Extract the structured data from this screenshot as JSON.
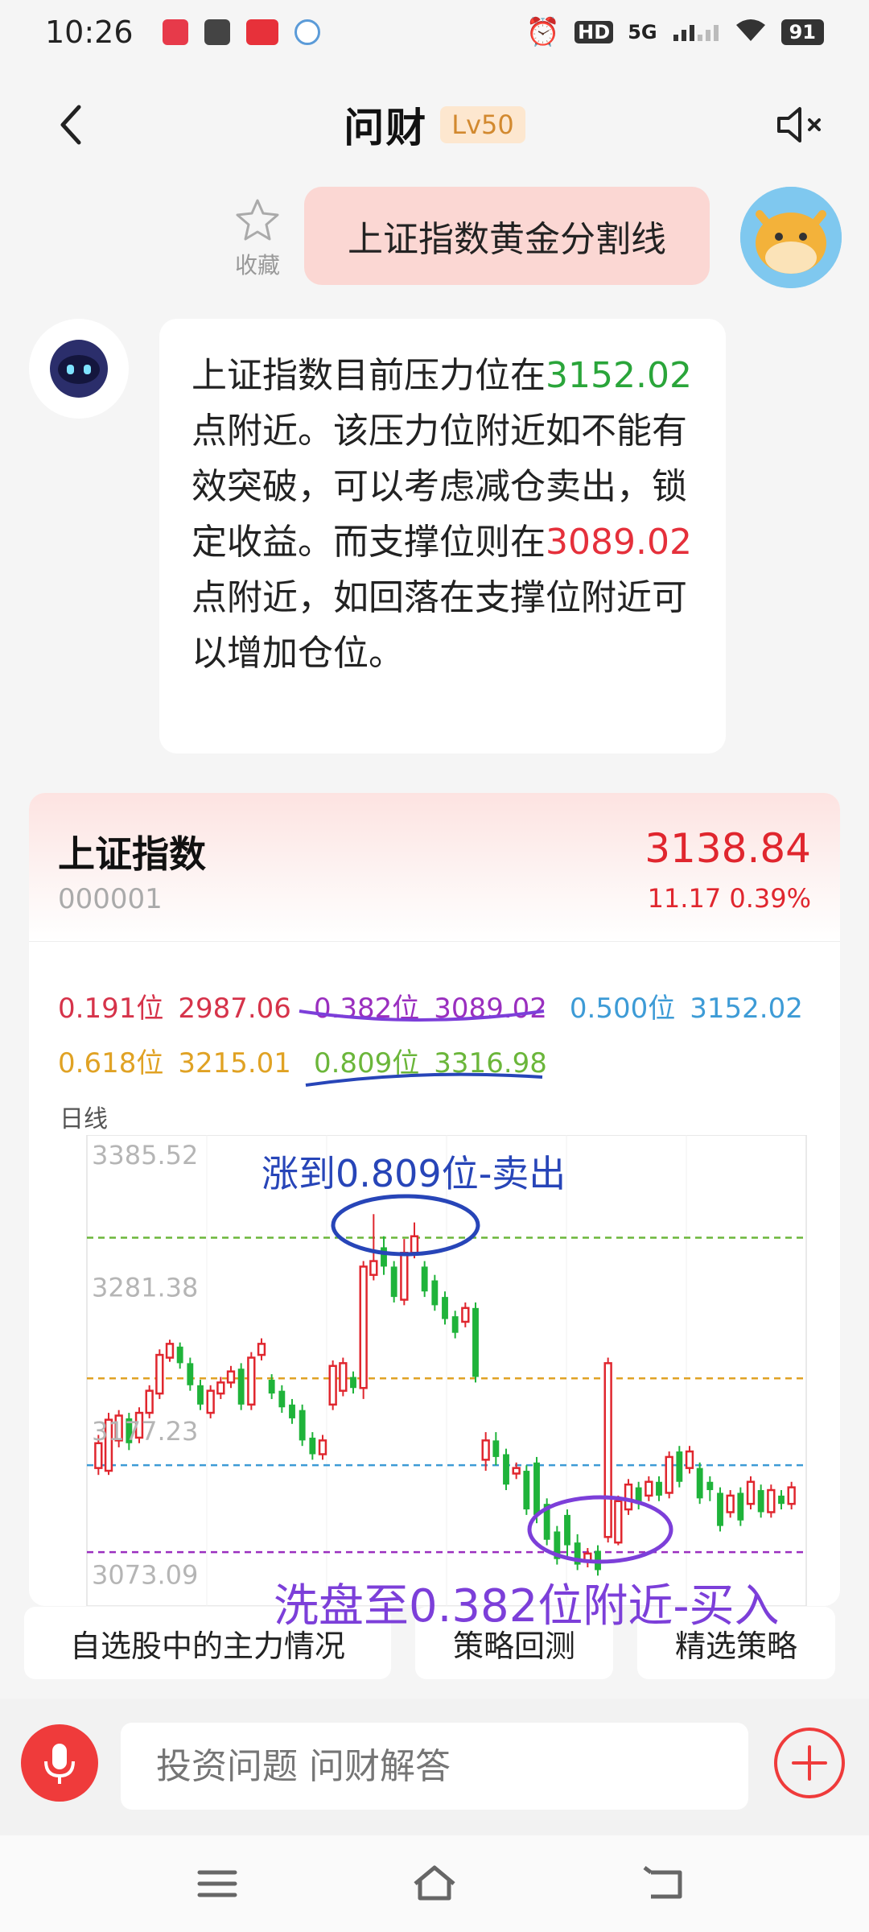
{
  "status_bar": {
    "time": "10:26",
    "network": "5G",
    "hd": "HD",
    "battery": "91"
  },
  "nav": {
    "title": "问财",
    "level": "Lv50"
  },
  "user_message": {
    "text": "上证指数黄金分割线",
    "favorite_label": "收藏"
  },
  "bot_message": {
    "part1": "上证指数目前压力位在",
    "resistance": "3152.02",
    "part2": "点附近。该压力位附近如不能有效突破，可以考虑减仓卖出，锁定收益。而支撑位则在",
    "support": "3089.02",
    "part3": "点附近，如回落在支撑位附近可以增加仓位。"
  },
  "stock": {
    "name": "上证指数",
    "code": "000001",
    "price": "3138.84",
    "change": "11.17 0.39%"
  },
  "fib_levels": [
    {
      "label": "0.191位",
      "value": "2987.06",
      "color": "#d6334a"
    },
    {
      "label": "0.382位",
      "value": "3089.02",
      "color": "#9a2fbf"
    },
    {
      "label": "0.500位",
      "value": "3152.02",
      "color": "#3d9bd6"
    },
    {
      "label": "0.618位",
      "value": "3215.01",
      "color": "#e0a224"
    },
    {
      "label": "0.809位",
      "value": "3316.98",
      "color": "#6bb63a"
    }
  ],
  "chart_period": "日线",
  "chart_data": {
    "type": "candlestick",
    "y_tick_labels": [
      "3385.52",
      "3281.38",
      "3177.23",
      "3073.09"
    ],
    "ylim": [
      3050,
      3385.52
    ],
    "reference_lines": [
      {
        "level": "0.809",
        "value": 3316.98,
        "color": "#6bb63a"
      },
      {
        "level": "0.618",
        "value": 3215.01,
        "color": "#e0a224"
      },
      {
        "level": "0.500",
        "value": 3152.02,
        "color": "#3d9bd6"
      },
      {
        "level": "0.382",
        "value": 3089.02,
        "color": "#9a2fbf"
      }
    ],
    "candles": [
      {
        "o": 3150,
        "c": 3168,
        "h": 3174,
        "l": 3145
      },
      {
        "o": 3148,
        "c": 3185,
        "h": 3190,
        "l": 3145
      },
      {
        "o": 3170,
        "c": 3188,
        "h": 3192,
        "l": 3165
      },
      {
        "o": 3186,
        "c": 3168,
        "h": 3190,
        "l": 3163
      },
      {
        "o": 3172,
        "c": 3190,
        "h": 3194,
        "l": 3168
      },
      {
        "o": 3190,
        "c": 3206,
        "h": 3210,
        "l": 3186
      },
      {
        "o": 3204,
        "c": 3232,
        "h": 3236,
        "l": 3200
      },
      {
        "o": 3230,
        "c": 3240,
        "h": 3243,
        "l": 3227
      },
      {
        "o": 3238,
        "c": 3226,
        "h": 3241,
        "l": 3222
      },
      {
        "o": 3226,
        "c": 3210,
        "h": 3230,
        "l": 3206
      },
      {
        "o": 3210,
        "c": 3196,
        "h": 3214,
        "l": 3192
      },
      {
        "o": 3190,
        "c": 3206,
        "h": 3210,
        "l": 3186
      },
      {
        "o": 3204,
        "c": 3212,
        "h": 3216,
        "l": 3200
      },
      {
        "o": 3212,
        "c": 3220,
        "h": 3224,
        "l": 3208
      },
      {
        "o": 3222,
        "c": 3196,
        "h": 3226,
        "l": 3192
      },
      {
        "o": 3196,
        "c": 3230,
        "h": 3234,
        "l": 3192
      },
      {
        "o": 3232,
        "c": 3240,
        "h": 3244,
        "l": 3228
      },
      {
        "o": 3214,
        "c": 3204,
        "h": 3218,
        "l": 3200
      },
      {
        "o": 3206,
        "c": 3194,
        "h": 3210,
        "l": 3190
      },
      {
        "o": 3196,
        "c": 3186,
        "h": 3200,
        "l": 3182
      },
      {
        "o": 3192,
        "c": 3170,
        "h": 3196,
        "l": 3166
      },
      {
        "o": 3172,
        "c": 3160,
        "h": 3176,
        "l": 3156
      },
      {
        "o": 3160,
        "c": 3170,
        "h": 3174,
        "l": 3156
      },
      {
        "o": 3196,
        "c": 3224,
        "h": 3228,
        "l": 3192
      },
      {
        "o": 3206,
        "c": 3226,
        "h": 3230,
        "l": 3202
      },
      {
        "o": 3216,
        "c": 3208,
        "h": 3220,
        "l": 3204
      },
      {
        "o": 3208,
        "c": 3296,
        "h": 3300,
        "l": 3200
      },
      {
        "o": 3290,
        "c": 3300,
        "h": 3334,
        "l": 3286
      },
      {
        "o": 3310,
        "c": 3296,
        "h": 3318,
        "l": 3290
      },
      {
        "o": 3296,
        "c": 3274,
        "h": 3300,
        "l": 3270
      },
      {
        "o": 3272,
        "c": 3306,
        "h": 3316,
        "l": 3268
      },
      {
        "o": 3306,
        "c": 3318,
        "h": 3328,
        "l": 3302
      },
      {
        "o": 3296,
        "c": 3278,
        "h": 3300,
        "l": 3274
      },
      {
        "o": 3286,
        "c": 3268,
        "h": 3290,
        "l": 3264
      },
      {
        "o": 3274,
        "c": 3258,
        "h": 3278,
        "l": 3254
      },
      {
        "o": 3260,
        "c": 3248,
        "h": 3264,
        "l": 3244
      },
      {
        "o": 3256,
        "c": 3266,
        "h": 3270,
        "l": 3252
      },
      {
        "o": 3266,
        "c": 3216,
        "h": 3270,
        "l": 3212
      },
      {
        "o": 3156,
        "c": 3170,
        "h": 3176,
        "l": 3148
      },
      {
        "o": 3170,
        "c": 3158,
        "h": 3176,
        "l": 3152
      },
      {
        "o": 3160,
        "c": 3138,
        "h": 3164,
        "l": 3134
      },
      {
        "o": 3146,
        "c": 3150,
        "h": 3154,
        "l": 3142
      },
      {
        "o": 3148,
        "c": 3120,
        "h": 3152,
        "l": 3116
      },
      {
        "o": 3154,
        "c": 3116,
        "h": 3158,
        "l": 3110
      },
      {
        "o": 3124,
        "c": 3098,
        "h": 3128,
        "l": 3094
      },
      {
        "o": 3104,
        "c": 3084,
        "h": 3108,
        "l": 3080
      },
      {
        "o": 3116,
        "c": 3094,
        "h": 3120,
        "l": 3084
      },
      {
        "o": 3096,
        "c": 3080,
        "h": 3102,
        "l": 3076
      },
      {
        "o": 3082,
        "c": 3088,
        "h": 3092,
        "l": 3078
      },
      {
        "o": 3090,
        "c": 3076,
        "h": 3094,
        "l": 3072
      },
      {
        "o": 3100,
        "c": 3226,
        "h": 3230,
        "l": 3096
      },
      {
        "o": 3096,
        "c": 3126,
        "h": 3130,
        "l": 3094
      },
      {
        "o": 3120,
        "c": 3138,
        "h": 3142,
        "l": 3116
      },
      {
        "o": 3136,
        "c": 3124,
        "h": 3140,
        "l": 3120
      },
      {
        "o": 3130,
        "c": 3140,
        "h": 3144,
        "l": 3126
      },
      {
        "o": 3140,
        "c": 3130,
        "h": 3144,
        "l": 3126
      },
      {
        "o": 3132,
        "c": 3158,
        "h": 3162,
        "l": 3128
      },
      {
        "o": 3162,
        "c": 3140,
        "h": 3166,
        "l": 3136
      },
      {
        "o": 3150,
        "c": 3162,
        "h": 3166,
        "l": 3146
      },
      {
        "o": 3150,
        "c": 3128,
        "h": 3154,
        "l": 3124
      },
      {
        "o": 3140,
        "c": 3134,
        "h": 3144,
        "l": 3126
      },
      {
        "o": 3132,
        "c": 3108,
        "h": 3136,
        "l": 3104
      },
      {
        "o": 3118,
        "c": 3130,
        "h": 3134,
        "l": 3114
      },
      {
        "o": 3132,
        "c": 3112,
        "h": 3136,
        "l": 3108
      },
      {
        "o": 3124,
        "c": 3140,
        "h": 3144,
        "l": 3120
      },
      {
        "o": 3134,
        "c": 3118,
        "h": 3138,
        "l": 3114
      },
      {
        "o": 3118,
        "c": 3134,
        "h": 3138,
        "l": 3114
      },
      {
        "o": 3130,
        "c": 3124,
        "h": 3134,
        "l": 3120
      },
      {
        "o": 3124,
        "c": 3136,
        "h": 3140,
        "l": 3120
      }
    ],
    "up_color": "#e0262e",
    "down_color": "#1fb33a"
  },
  "annotations": {
    "sell": "涨到0.809位-卖出",
    "buy": "洗盘至0.382位附近-买入"
  },
  "quick_actions": [
    "自选股中的主力情况",
    "策略回测",
    "精选策略"
  ],
  "input": {
    "placeholder": "投资问题 问财解答"
  }
}
